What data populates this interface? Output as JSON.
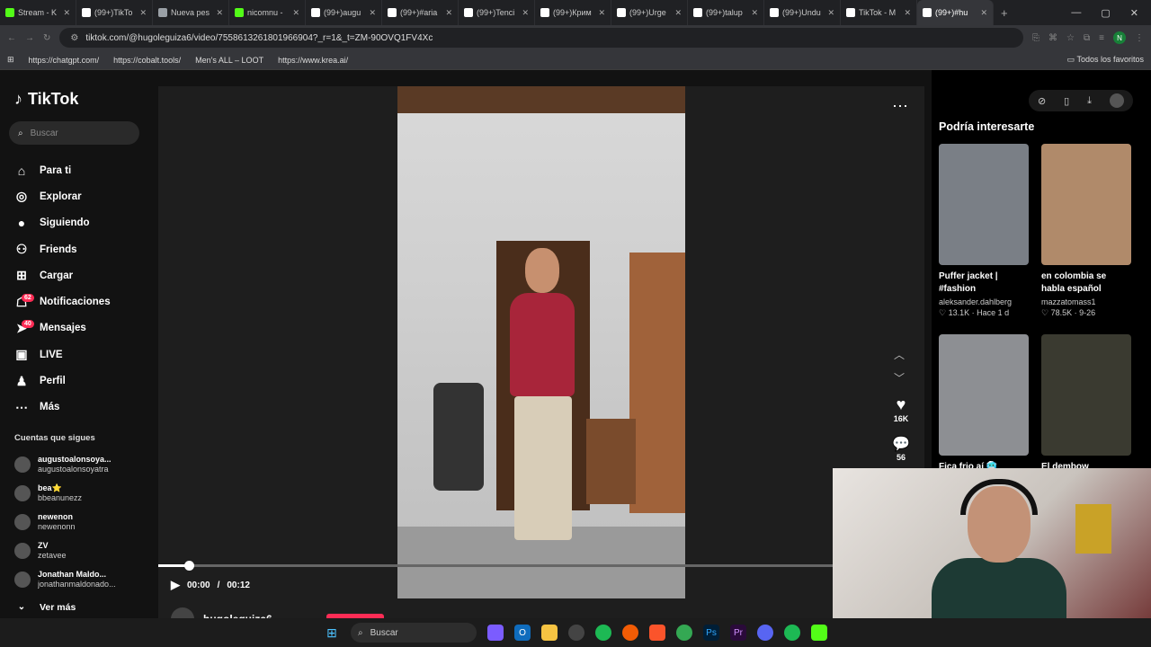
{
  "browser": {
    "tabs": [
      {
        "title": "Stream - K",
        "color": "#53fc18"
      },
      {
        "title": "(99+)TikTo",
        "color": "#ffffff"
      },
      {
        "title": "Nueva pes",
        "color": "#9aa0a6"
      },
      {
        "title": "nicomnu -",
        "color": "#53fc18"
      },
      {
        "title": "(99+)augu",
        "color": "#ffffff"
      },
      {
        "title": "(99+)#aria",
        "color": "#ffffff"
      },
      {
        "title": "(99+)Tenci",
        "color": "#ffffff"
      },
      {
        "title": "(99+)Крим",
        "color": "#ffffff"
      },
      {
        "title": "(99+)Urge",
        "color": "#ffffff"
      },
      {
        "title": "(99+)talup",
        "color": "#ffffff"
      },
      {
        "title": "(99+)Undu",
        "color": "#ffffff"
      },
      {
        "title": "TikTok - M",
        "color": "#ffffff"
      },
      {
        "title": "(99+)#hu",
        "color": "#ffffff",
        "active": true
      }
    ],
    "url": "tiktok.com/@hugoleguiza6/video/7558613261801966904?_r=1&_t=ZM-90OVQ1FV4Xc",
    "profile_initial": "N",
    "bookmarks": [
      "https://chatgpt.com/",
      "https://cobalt.tools/",
      "Men's ALL – LOOT",
      "https://www.krea.ai/"
    ],
    "all_favorites": "Todos los favoritos"
  },
  "sidebar": {
    "logo": "TikTok",
    "search_placeholder": "Buscar",
    "nav": [
      {
        "label": "Para ti",
        "icon": "home-icon",
        "glyph": "⌂"
      },
      {
        "label": "Explorar",
        "icon": "compass-icon",
        "glyph": "◎"
      },
      {
        "label": "Siguiendo",
        "icon": "following-icon",
        "glyph": "●"
      },
      {
        "label": "Friends",
        "icon": "friends-icon",
        "glyph": "⚇"
      },
      {
        "label": "Cargar",
        "icon": "upload-icon",
        "glyph": "⊞"
      },
      {
        "label": "Notificaciones",
        "icon": "notifications-icon",
        "glyph": "☖",
        "badge": "62"
      },
      {
        "label": "Mensajes",
        "icon": "messages-icon",
        "glyph": "➤",
        "badge": "40"
      },
      {
        "label": "LIVE",
        "icon": "live-icon",
        "glyph": "▣"
      },
      {
        "label": "Perfil",
        "icon": "profile-icon",
        "glyph": "♟"
      },
      {
        "label": "Más",
        "icon": "more-icon",
        "glyph": "⋯"
      }
    ],
    "following_title": "Cuentas que sigues",
    "following": [
      {
        "name": "augustoalonsoya...",
        "handle": "augustoalonsoyatra"
      },
      {
        "name": "bea⭐",
        "handle": "bbeanunezz"
      },
      {
        "name": "newenon",
        "handle": "newenonn"
      },
      {
        "name": "ZV",
        "handle": "zetavee"
      },
      {
        "name": "Jonathan Maldo...",
        "handle": "jonathanmaldonado..."
      }
    ],
    "see_more": "Ver más"
  },
  "player": {
    "current_time": "00:00",
    "duration": "00:12",
    "progress": 0.045,
    "likes": "16K",
    "comments": "56",
    "author": "hugoleguiza6"
  },
  "recommendations": {
    "title": "Podría interesarte",
    "cards": [
      {
        "title": "Puffer jacket | #fashion",
        "user": "aleksander.dahlberg",
        "stats": "♡ 13.1K · Hace 1 d",
        "color": "#7a7f86"
      },
      {
        "title": "en colombia se habla español",
        "user": "mazzatomass1",
        "stats": "♡ 78.5K · 9-26",
        "color": "#b08a6a"
      },
      {
        "title": "Fica frio aí 🥶",
        "user": "",
        "stats": "",
        "color": "#8d8f93"
      },
      {
        "title": "El dembow argentino",
        "user": "",
        "stats": "",
        "color": "#3a3a30"
      }
    ]
  },
  "taskbar": {
    "search_placeholder": "Buscar"
  }
}
